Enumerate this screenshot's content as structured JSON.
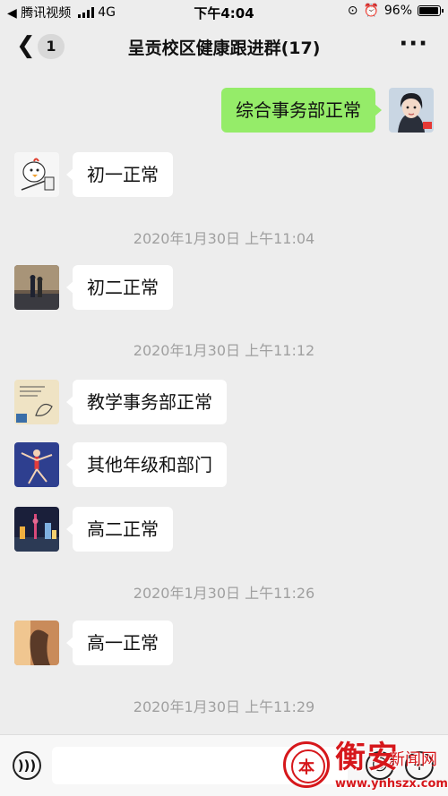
{
  "status_bar": {
    "back_app": "◀ 腾讯视频",
    "network": "4G",
    "time": "下午4:04",
    "battery": "96%",
    "battery_level": 0.96
  },
  "header": {
    "back_icon": "chevron-left-icon",
    "unread_count": "1",
    "title": "呈贡校区健康跟进群(17)",
    "more_icon": "ellipsis-icon"
  },
  "messages": [
    {
      "side": "right",
      "text": "综合事务部正常",
      "avatar": "avatar-girl-cartoon"
    },
    {
      "side": "left",
      "text": "初一正常",
      "avatar": "avatar-cartoon-chicken"
    },
    {
      "timestamp": "2020年1月30日 上午11:04"
    },
    {
      "side": "left",
      "text": "初二正常",
      "avatar": "avatar-couple-photo"
    },
    {
      "timestamp": "2020年1月30日 上午11:12"
    },
    {
      "side": "left",
      "text": "教学事务部正常",
      "avatar": "avatar-sketch-note"
    },
    {
      "side": "left",
      "text": "其他年级和部门",
      "avatar": "avatar-dancer"
    },
    {
      "side": "left",
      "text": "高二正常",
      "avatar": "avatar-city-night"
    },
    {
      "timestamp": "2020年1月30日 上午11:26"
    },
    {
      "side": "left",
      "text": "高一正常",
      "avatar": "avatar-portrait"
    },
    {
      "timestamp": "2020年1月30日 上午11:29"
    }
  ],
  "input_bar": {
    "voice_icon": "voice-icon",
    "emoji_icon": "emoji-icon",
    "plus_icon": "plus-icon"
  },
  "watermark": {
    "brand": "衡安",
    "site": "新闻网",
    "url": "www.ynhszx.com"
  },
  "colors": {
    "background": "#ededed",
    "sent_bubble": "#95ec69",
    "received_bubble": "#ffffff",
    "timestamp_text": "#a0a0a0",
    "watermark_red": "#d6171b"
  }
}
